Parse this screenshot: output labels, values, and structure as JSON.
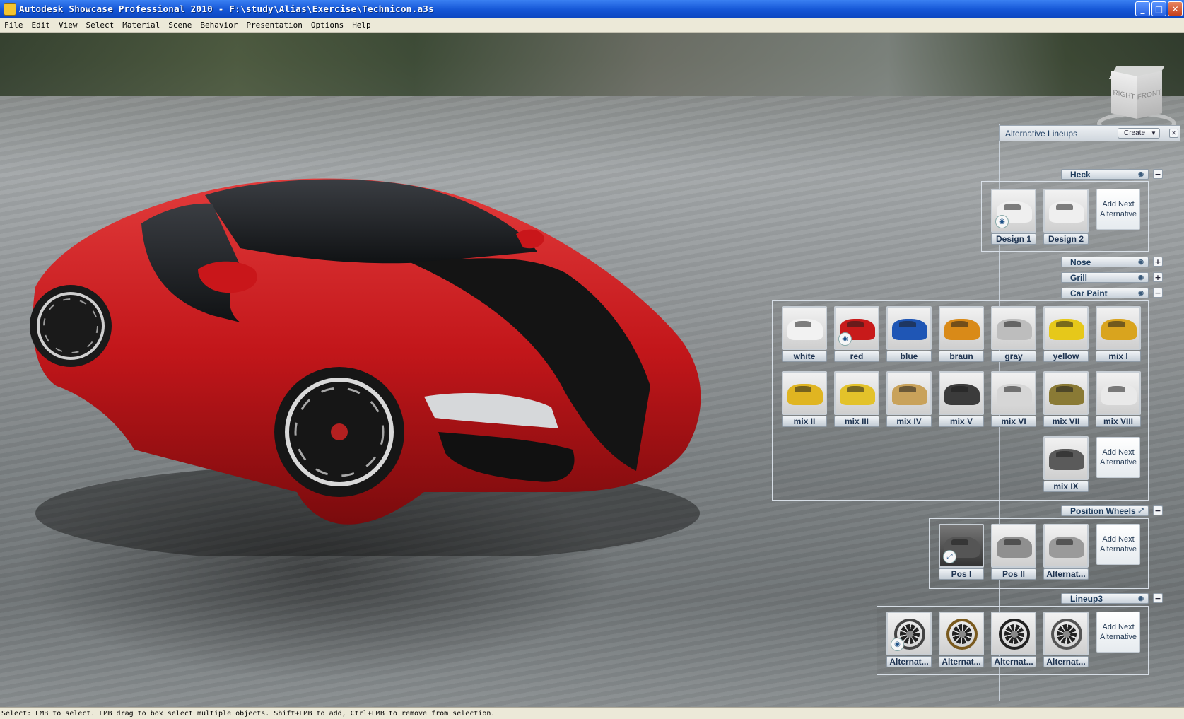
{
  "window": {
    "title": "Autodesk Showcase Professional 2010 - F:\\study\\Alias\\Exercise\\Technicon.a3s",
    "controls": {
      "minimize": "_",
      "maximize": "□",
      "close": "✕"
    }
  },
  "menu": [
    "File",
    "Edit",
    "View",
    "Select",
    "Material",
    "Scene",
    "Behavior",
    "Presentation",
    "Options",
    "Help"
  ],
  "navcube": {
    "left": "RIGHT",
    "right": "FRONT"
  },
  "lineups": {
    "title": "Alternative Lineups",
    "create_label": "Create",
    "add_next_label": "Add Next Alternative",
    "groups": [
      {
        "name": "Heck",
        "toggle": "−",
        "items": [
          "Design 1",
          "Design 2"
        ]
      },
      {
        "name": "Nose",
        "toggle": "+",
        "items": []
      },
      {
        "name": "Grill",
        "toggle": "+",
        "items": []
      },
      {
        "name": "Car Paint",
        "toggle": "−",
        "items": [
          "white",
          "red",
          "blue",
          "braun",
          "gray",
          "yellow",
          "mix I",
          "mix II",
          "mix III",
          "mix IV",
          "mix V",
          "mix VI",
          "mix VII",
          "mix VIII",
          "mix IX"
        ]
      },
      {
        "name": "Position Wheels",
        "toggle": "−",
        "items": [
          "Pos I",
          "Pos II",
          "Alternat..."
        ]
      },
      {
        "name": "Lineup3",
        "toggle": "−",
        "items": [
          "Alternat...",
          "Alternat...",
          "Alternat...",
          "Alternat..."
        ]
      }
    ],
    "paint_colors": [
      "#f2f2f2",
      "#c81a1a",
      "#1f56b5",
      "#d98a18",
      "#bdbdbd",
      "#e6c81a",
      "#d9a41e",
      "#e0b521",
      "#e3c22a",
      "#c9a25a",
      "#3b3b3b",
      "#d6d6d6",
      "#8a7a35",
      "#e9e9e9",
      "#5a5a5a"
    ]
  },
  "status": {
    "text": "Select: LMB to select. LMB drag to box select multiple objects. Shift+LMB to add, Ctrl+LMB to remove from selection."
  }
}
